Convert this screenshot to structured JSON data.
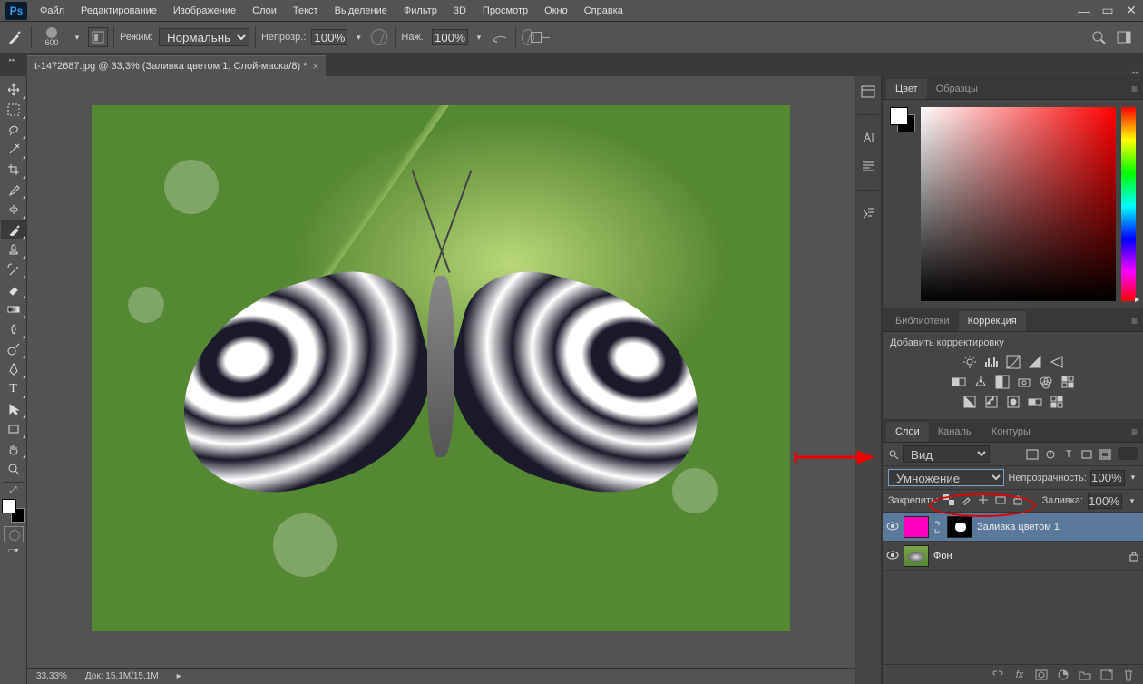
{
  "menu": {
    "items": [
      "Файл",
      "Редактирование",
      "Изображение",
      "Слои",
      "Текст",
      "Выделение",
      "Фильтр",
      "3D",
      "Просмотр",
      "Окно",
      "Справка"
    ]
  },
  "options": {
    "brush_size": "600",
    "mode_label": "Режим:",
    "mode_value": "Нормальный",
    "opacity_label": "Непрозр.:",
    "opacity_value": "100%",
    "flow_label": "Наж.:",
    "flow_value": "100%"
  },
  "document": {
    "tab_title": "t-1472687.jpg @ 33,3% (Заливка цветом 1, Слой-маска/8) *"
  },
  "status": {
    "zoom": "33,33%",
    "doc": "Док: 15,1M/15,1M"
  },
  "panels": {
    "color": {
      "tab_color": "Цвет",
      "tab_swatches": "Образцы"
    },
    "adjust": {
      "tab_lib": "Библиотеки",
      "tab_adj": "Коррекция",
      "add_label": "Добавить корректировку"
    },
    "layers": {
      "tab_layers": "Слои",
      "tab_channels": "Каналы",
      "tab_paths": "Контуры",
      "kind_label": "Вид",
      "blend_mode": "Умножение",
      "opacity_label": "Непрозрачность:",
      "opacity_value": "100%",
      "lock_label": "Закрепить:",
      "fill_label": "Заливка:",
      "fill_value": "100%",
      "items": [
        {
          "name": "Заливка цветом 1"
        },
        {
          "name": "Фон"
        }
      ]
    }
  }
}
